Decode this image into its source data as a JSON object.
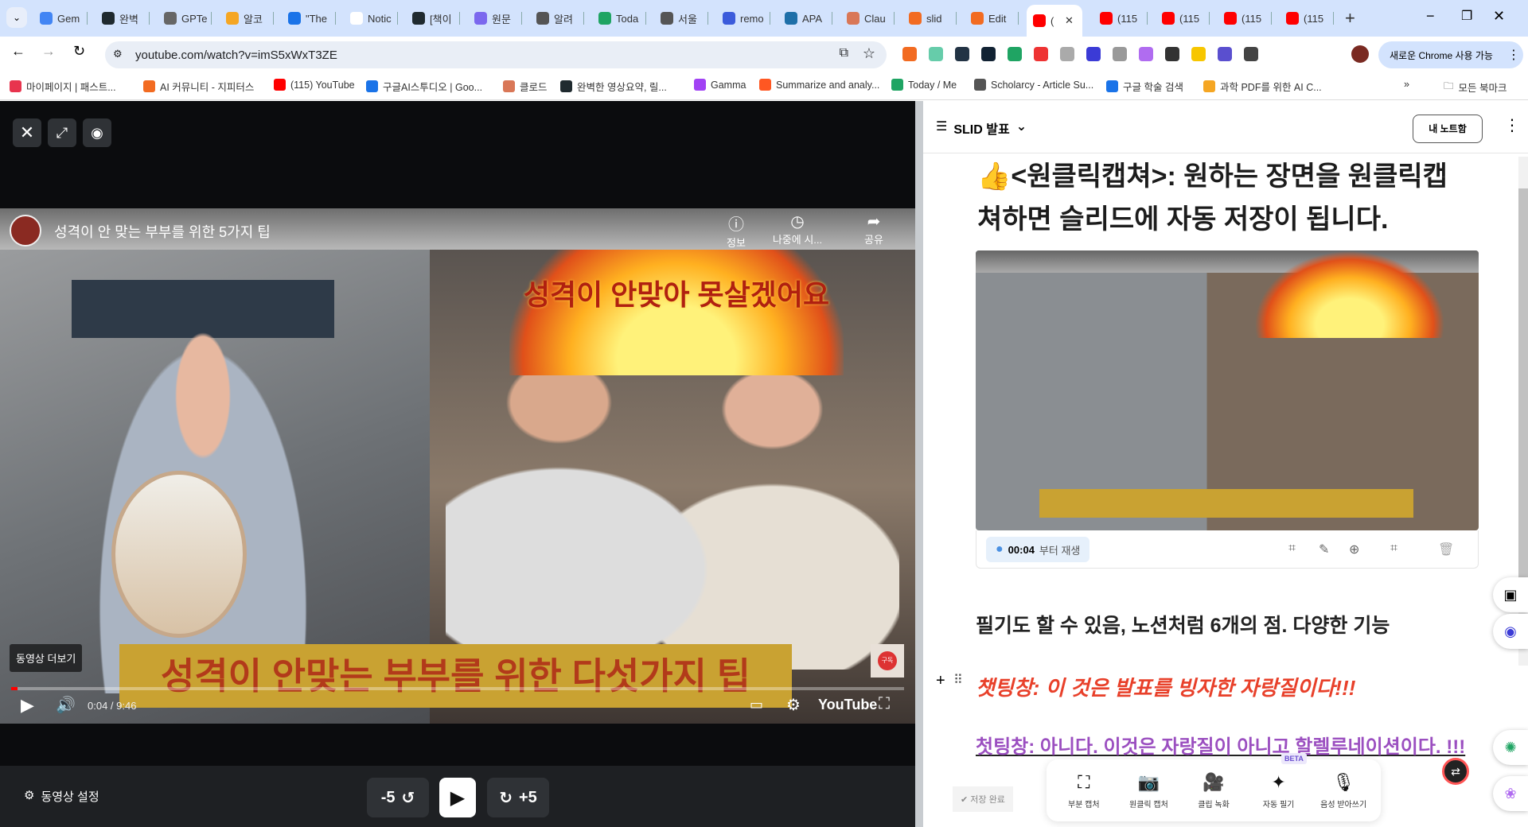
{
  "browser": {
    "tabs": [
      "Gem",
      "완벽",
      "GPTe",
      "알코",
      "\"The",
      "Notic",
      "[책이",
      "원문",
      "알려",
      "Toda",
      "서울",
      "remo",
      "APA",
      "Clau",
      "slid",
      "Edit",
      "(",
      "(115",
      "(115",
      "(115",
      "(115"
    ],
    "tab_colors": [
      "#4285f4",
      "#1f2a2f",
      "#666",
      "#f5a623",
      "#1a73e8",
      "#fff",
      "#1f2a2f",
      "#7b68ee",
      "#555",
      "#1fa463",
      "#555",
      "#3b5bdb",
      "#1e6fa8",
      "#d97757",
      "#f26b21",
      "#f26b21",
      "#ff0000",
      "#ff0000",
      "#ff0000",
      "#ff0000",
      "#ff0000"
    ],
    "url": "youtube.com/watch?v=imS5xWxT3ZE",
    "new_chrome": "새로운 Chrome 사용 가능",
    "bookmarks": [
      "마이페이지 | 패스트...",
      "AI 커뮤니티 - 지피터스",
      "(115) YouTube",
      "구글AI스투디오 | Goo...",
      "클로드",
      "완벽한 영상요약, 릴...",
      "Gamma",
      "Summarize and analy...",
      "Today / Me",
      "Scholarcy - Article Su...",
      "구글 학술 검색",
      "과학 PDF를 위한 AI C..."
    ],
    "bookmark_colors": [
      "#e8344e",
      "#f26b21",
      "#ff0000",
      "#1a73e8",
      "#d97757",
      "#1f2a2f",
      "#a142f4",
      "#ff5722",
      "#1fa463",
      "#555",
      "#1a73e8",
      "#f5a623"
    ],
    "all_bookmarks": "모든 북마크",
    "extension_colors": [
      "#f26b21",
      "#6ca",
      "#234",
      "#123",
      "#1fa463",
      "#e33",
      "#aaa",
      "#3b3bd6",
      "#999",
      "#b06cf0",
      "#333",
      "#f7c600",
      "#5a4fcf",
      "#444"
    ]
  },
  "player": {
    "video_title": "성격이 안 맞는 부부를 위한 5가지 팁",
    "info_label": "정보",
    "watch_later_label": "나중에 시...",
    "share_label": "공유",
    "overlay_text": "성격이 안맞아 못살겠어요",
    "banner_text": "성격이 안맞는 부부를 위한 다섯가지 팁",
    "more_videos": "동영상 더보기",
    "subscribe": "구독",
    "time": "0:04 / 9:46",
    "progress_percent": 0.7,
    "youtube_logo": "YouTube",
    "settings_label": "동영상 설정",
    "back5": "-5",
    "fwd5": "+5"
  },
  "notes": {
    "title": "SLID 발표",
    "my_notes": "내 노트함",
    "heading_emoji": "👍",
    "heading": "<원클릭캡쳐>: 원하는 장면을 원클릭캡쳐하면 슬리드에 자동 저장이 됩니다.",
    "capture_time": "00:04",
    "capture_play_suffix": "부터 재생",
    "line1": "필기도 할 수 있음, 노션처럼 6개의 점. 다양한 기능",
    "line2": "챗팅창: 이 것은 발표를 빙자한 자랑질이다!!!",
    "line3": "첫팅창: 아니다. 이것은 자랑질이 아니고 할렐루네이션이다. !!!",
    "saved": "✔ 저장 완료",
    "beta": "BETA",
    "tools": [
      {
        "label": "부분 캡처",
        "icon": "⛶"
      },
      {
        "label": "원클릭 캡처",
        "icon": "📷"
      },
      {
        "label": "클립 녹화",
        "icon": "🎥"
      },
      {
        "label": "자동 필기",
        "icon": "✦"
      },
      {
        "label": "음성 받아쓰기",
        "icon": "🎙"
      }
    ]
  }
}
